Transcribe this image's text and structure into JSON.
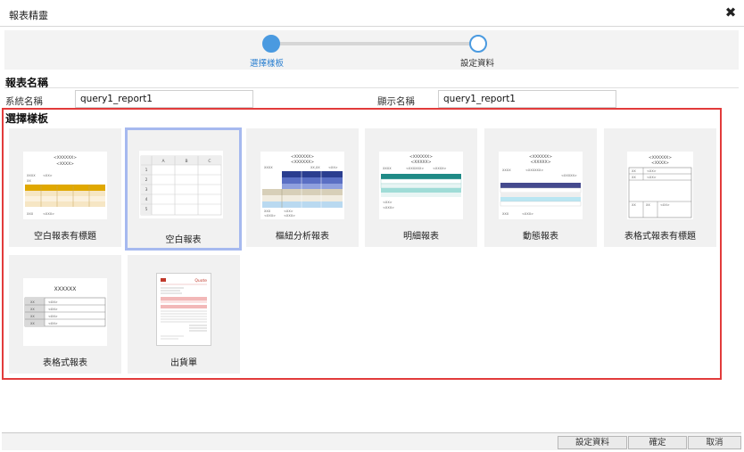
{
  "dialog": {
    "title": "報表精靈",
    "close_icon": "close-icon"
  },
  "wizard": {
    "steps": [
      {
        "label": "選擇樣板",
        "state": "active"
      },
      {
        "label": "設定資料",
        "state": "pending"
      }
    ],
    "active_color": "#4a9ae0"
  },
  "report_name": {
    "section_title": "報表名稱",
    "system_name_label": "系統名稱",
    "system_name_value": "query1_report1",
    "display_name_label": "顯示名稱",
    "display_name_value": "query1_report1"
  },
  "templates": {
    "section_title": "選擇樣板",
    "highlight_color": "#e23b3b",
    "selected_color": "#a6b9ef",
    "items": [
      {
        "name": "空白報表有標題",
        "selected": false
      },
      {
        "name": "空白報表",
        "selected": true
      },
      {
        "name": "樞紐分析報表",
        "selected": false
      },
      {
        "name": "明細報表",
        "selected": false
      },
      {
        "name": "動態報表",
        "selected": false
      },
      {
        "name": "表格式報表有標題",
        "selected": false
      },
      {
        "name": "表格式報表",
        "selected": false
      },
      {
        "name": "出貨單",
        "selected": false
      }
    ],
    "thumbnails": {
      "blank_columns": [
        "A",
        "B",
        "C"
      ],
      "blank_rows": [
        "1",
        "2",
        "3",
        "4",
        "5"
      ],
      "tabular_title": "XXXXXX",
      "placeholder_title": "<XXXXXX>",
      "placeholder_sub": "<XXXX>",
      "placeholder_cell": "<XX>",
      "placeholder_short": "XX",
      "invoice_title": "Quote"
    }
  },
  "footer": {
    "settings_button": "設定資料",
    "confirm_button": "確定",
    "cancel_button": "取消"
  }
}
